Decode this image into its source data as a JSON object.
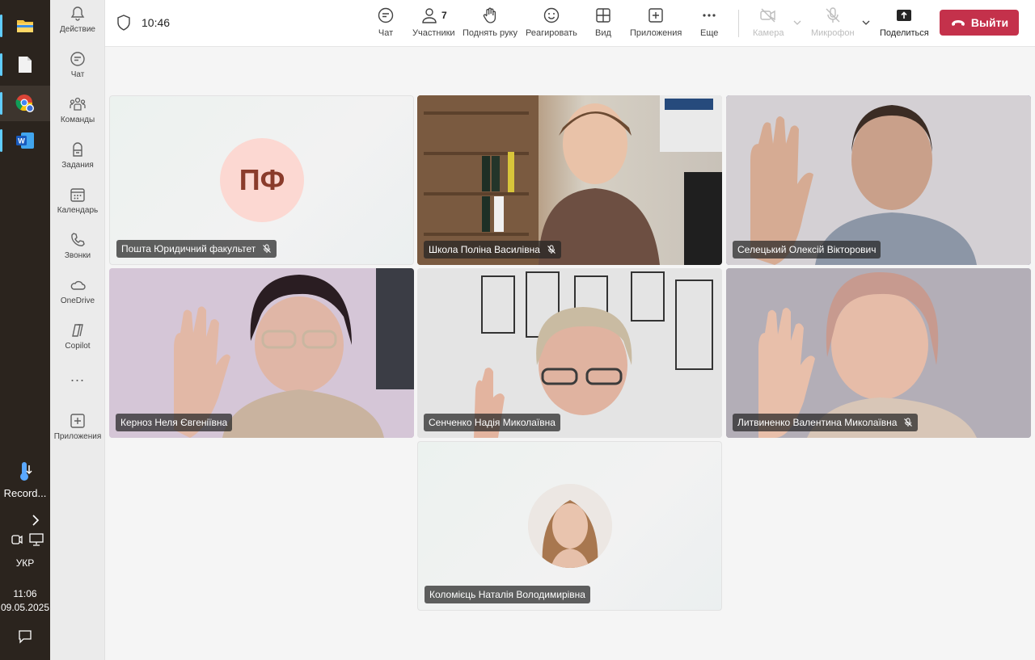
{
  "taskbar": {
    "recording_label": "Record...",
    "lang": "УКР",
    "clock_time": "11:06",
    "clock_date": "09.05.2025"
  },
  "rail": {
    "items": [
      {
        "label": "Действие",
        "icon": "bell-icon"
      },
      {
        "label": "Чат",
        "icon": "chat-icon"
      },
      {
        "label": "Команды",
        "icon": "teams-icon"
      },
      {
        "label": "Задания",
        "icon": "assignments-icon"
      },
      {
        "label": "Календарь",
        "icon": "calendar-icon"
      },
      {
        "label": "Звонки",
        "icon": "phone-icon"
      },
      {
        "label": "OneDrive",
        "icon": "cloud-icon"
      },
      {
        "label": "Copilot",
        "icon": "copilot-icon"
      },
      {
        "label": "Приложения",
        "icon": "add-apps-icon"
      }
    ],
    "more_label": "..."
  },
  "meeting": {
    "time": "10:46",
    "participants_count": "7",
    "toolbar": {
      "chat": "Чат",
      "participants": "Участники",
      "raise_hand": "Поднять руку",
      "react": "Реагировать",
      "view": "Вид",
      "apps": "Приложения",
      "more": "Еще",
      "camera": "Камера",
      "mic": "Микрофон",
      "share": "Поделиться",
      "leave": "Выйти"
    },
    "accent_color": "#6264a7",
    "leave_color": "#c4314b"
  },
  "participants": [
    {
      "name": "Пошта Юридичний факультет",
      "initials": "ПФ",
      "muted": true,
      "video": false
    },
    {
      "name": "Школа Поліна Василівна",
      "muted": true,
      "video": true
    },
    {
      "name": "Селецький Олексій Вікторович",
      "muted": false,
      "video": true,
      "active_speaker": true
    },
    {
      "name": "Керноз Неля Євгеніївна",
      "muted": false,
      "video": true
    },
    {
      "name": "Сенченко Надія Миколаївна",
      "muted": false,
      "video": true
    },
    {
      "name": "Литвиненко Валентина Миколаївна",
      "muted": true,
      "video": true
    },
    {
      "name": "Коломієць Наталія Володимирівна",
      "muted": false,
      "video": false
    }
  ]
}
